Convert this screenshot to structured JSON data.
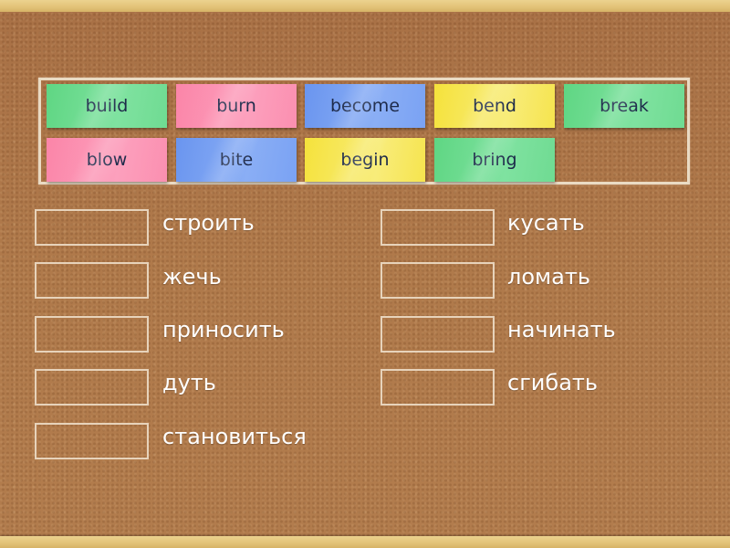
{
  "game": {
    "type": "match-up",
    "bank_cards": [
      {
        "word": "build",
        "color": "green"
      },
      {
        "word": "burn",
        "color": "pink"
      },
      {
        "word": "become",
        "color": "blue"
      },
      {
        "word": "bend",
        "color": "yellow"
      },
      {
        "word": "break",
        "color": "green"
      },
      {
        "word": "blow",
        "color": "pink"
      },
      {
        "word": "bite",
        "color": "blue"
      },
      {
        "word": "begin",
        "color": "yellow"
      },
      {
        "word": "bring",
        "color": "green"
      }
    ],
    "targets_left": [
      {
        "label": "строить"
      },
      {
        "label": "жечь"
      },
      {
        "label": "приносить"
      },
      {
        "label": "дуть"
      },
      {
        "label": "становиться"
      }
    ],
    "targets_right": [
      {
        "label": "кусать"
      },
      {
        "label": "ломать"
      },
      {
        "label": "начинать"
      },
      {
        "label": "сгибать"
      }
    ]
  },
  "colors": {
    "green": "#6fdb92",
    "pink": "#fb8fb0",
    "blue": "#7aa2f3",
    "yellow": "#f6e44e",
    "cork": "#b07a4b",
    "frame": "#e2c277",
    "text_dark": "#1d2a4a",
    "text_light": "#ffffff"
  }
}
